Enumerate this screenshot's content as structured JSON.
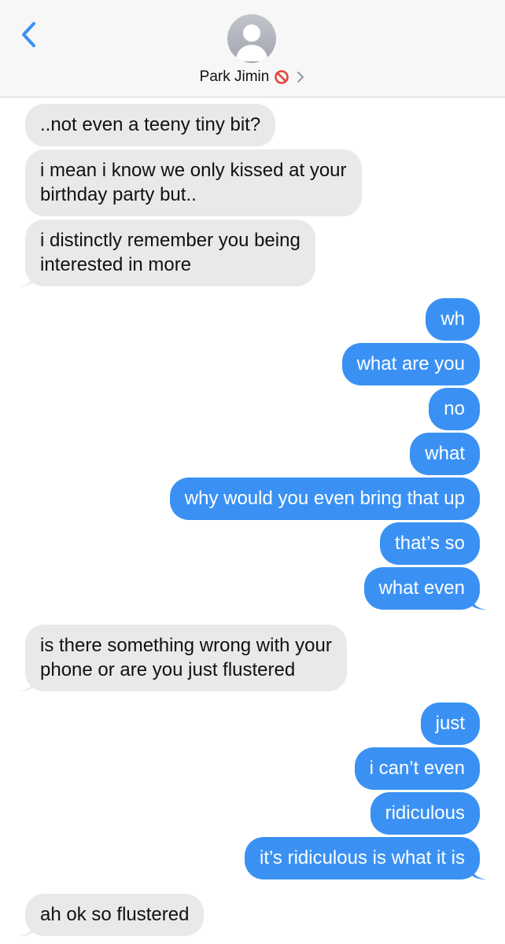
{
  "header": {
    "contact_name": "Park Jimin",
    "back_icon": "chevron-left-icon",
    "status_icon": "blocked-icon",
    "disclosure_icon": "chevron-right-icon",
    "accent_color": "#3a91f3"
  },
  "messages": [
    {
      "dir": "in",
      "lines": [
        "..not even a teeny tiny bit?"
      ]
    },
    {
      "dir": "in",
      "lines": [
        "i mean i know we only kissed at your",
        "birthday party but.."
      ]
    },
    {
      "dir": "in",
      "lines": [
        "i distinctly remember you being",
        "interested in more"
      ]
    },
    {
      "dir": "out",
      "lines": [
        "wh"
      ]
    },
    {
      "dir": "out",
      "lines": [
        "what are you"
      ]
    },
    {
      "dir": "out",
      "lines": [
        "no"
      ]
    },
    {
      "dir": "out",
      "lines": [
        "what"
      ]
    },
    {
      "dir": "out",
      "lines": [
        "why would you even bring that up"
      ]
    },
    {
      "dir": "out",
      "lines": [
        "that’s so"
      ]
    },
    {
      "dir": "out",
      "lines": [
        "what even"
      ]
    },
    {
      "dir": "in",
      "lines": [
        "is there something wrong with your",
        "phone or are you just flustered"
      ]
    },
    {
      "dir": "out",
      "lines": [
        "just"
      ]
    },
    {
      "dir": "out",
      "lines": [
        "i can’t even"
      ]
    },
    {
      "dir": "out",
      "lines": [
        "ridiculous"
      ]
    },
    {
      "dir": "out",
      "lines": [
        "it’s ridiculous is what it is"
      ]
    },
    {
      "dir": "in",
      "lines": [
        "ah ok so flustered"
      ]
    }
  ]
}
